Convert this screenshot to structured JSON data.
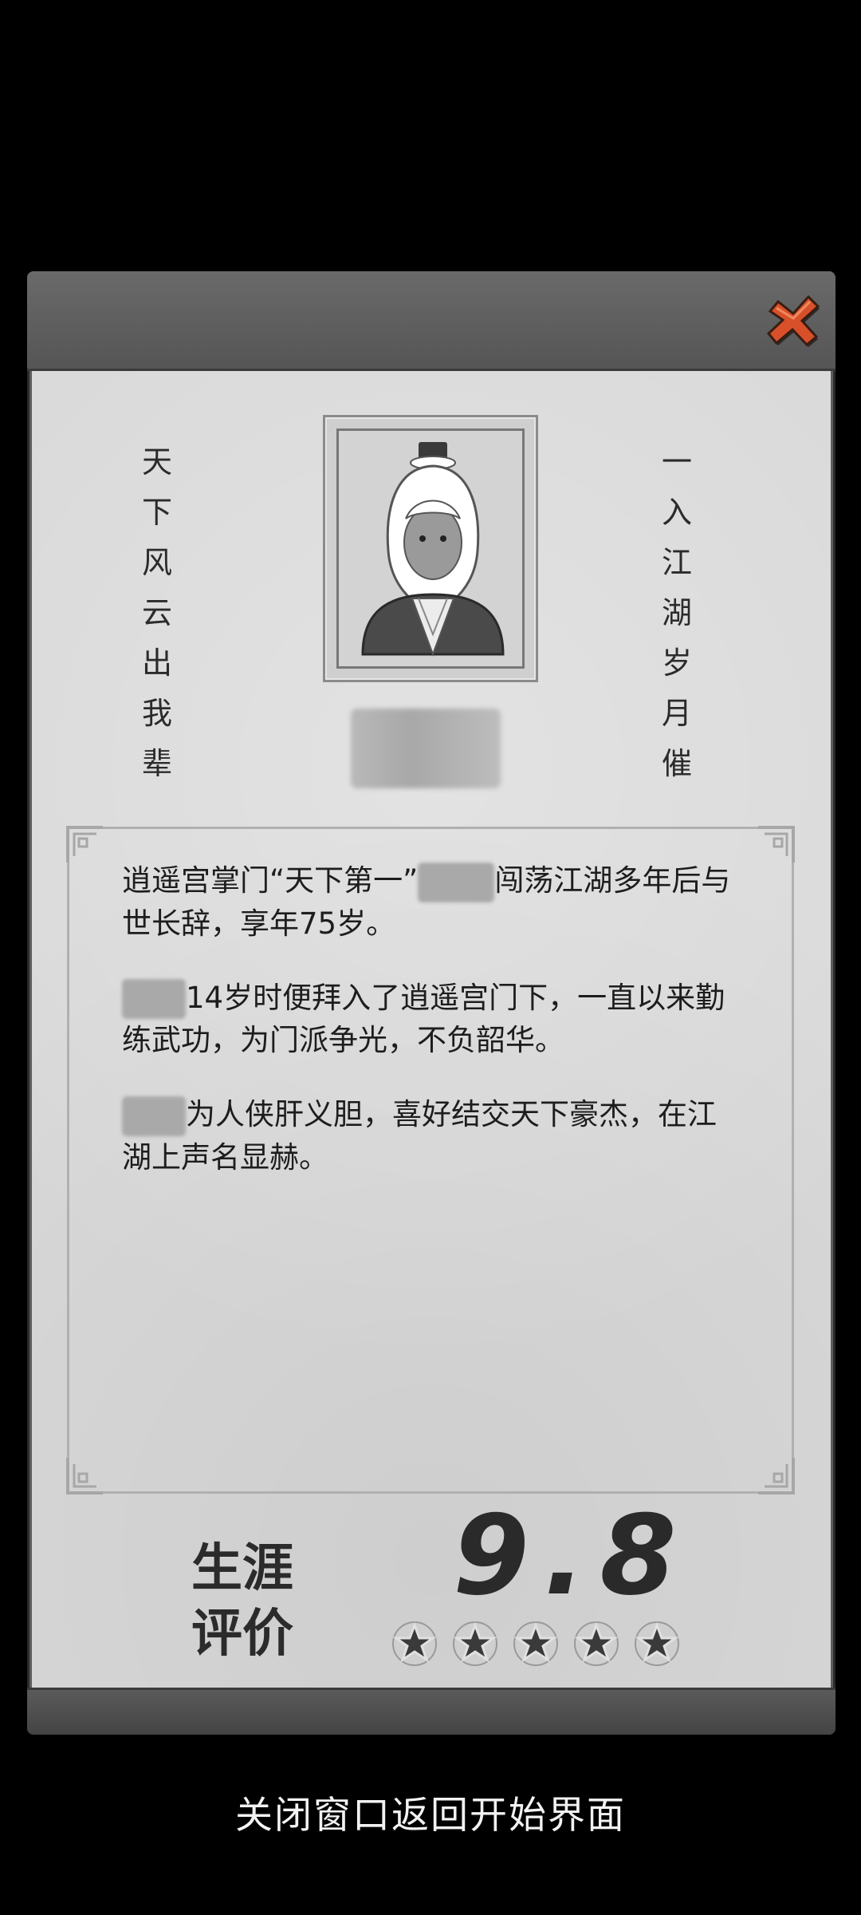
{
  "couplet": {
    "left": [
      "天",
      "下",
      "风",
      "云",
      "出",
      "我",
      "辈"
    ],
    "right": [
      "一",
      "入",
      "江",
      "湖",
      "岁",
      "月",
      "催"
    ]
  },
  "bio": {
    "p1_a": "逍遥宫掌门“天下第一”",
    "p1_b": "闯荡江湖多年后与世长辞，享年75岁。",
    "p2_a": "14岁时便拜入了逍遥宫门下，一直以来勤练武功，为门派争光，不负韶华。",
    "p3_a": "为人侠肝义胆，喜好结交天下豪杰，在江湖上声名显赫。"
  },
  "rating": {
    "label_line1": "生涯",
    "label_line2": "评价",
    "score": "9.8",
    "stars": 5
  },
  "hint": "关闭窗口返回开始界面",
  "icons": {
    "close": "close-x-icon",
    "star": "star-icon"
  },
  "colors": {
    "close_button": "#d8502a",
    "star_fill": "#3a3a3a",
    "star_outline": "#e0e0e0"
  }
}
